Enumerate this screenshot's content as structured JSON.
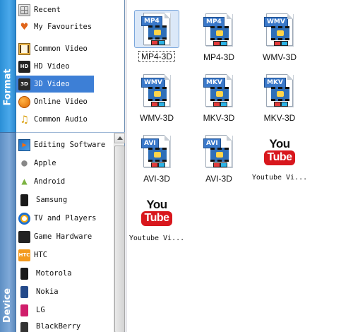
{
  "tabs": {
    "format": "Format",
    "device": "Device"
  },
  "format_categories": [
    {
      "label": "Recent",
      "icon": "grid-icon",
      "selected": false
    },
    {
      "label": "My Favourites",
      "icon": "heart-icon",
      "selected": false
    },
    {
      "label": "Common Video",
      "icon": "film-icon",
      "selected": false
    },
    {
      "label": "HD Video",
      "icon": "hd-icon",
      "badge": "HD",
      "selected": false
    },
    {
      "label": "3D Video",
      "icon": "3d-icon",
      "badge": "3D",
      "selected": true
    },
    {
      "label": "Online Video",
      "icon": "globe-icon",
      "selected": false
    },
    {
      "label": "Common Audio",
      "icon": "music-icon",
      "selected": false
    }
  ],
  "device_categories": [
    {
      "label": "Editing Software",
      "icon": "editing-icon"
    },
    {
      "label": "Apple",
      "icon": "apple-icon"
    },
    {
      "label": "Android",
      "icon": "android-icon"
    },
    {
      "label": "Samsung",
      "icon": "phone-icon"
    },
    {
      "label": "TV and Players",
      "icon": "tv-icon"
    },
    {
      "label": "Game Hardware",
      "icon": "gamepad-icon"
    },
    {
      "label": "HTC",
      "icon": "htc-icon",
      "badge": "HTC"
    },
    {
      "label": "Motorola",
      "icon": "phone-icon"
    },
    {
      "label": "Nokia",
      "icon": "phone-icon"
    },
    {
      "label": "LG",
      "icon": "phone-icon"
    },
    {
      "label": "BlackBerry",
      "icon": "phone-icon"
    }
  ],
  "formats": [
    {
      "label": "MP4-3D",
      "badge": "MP4",
      "selected": true
    },
    {
      "label": "MP4-3D",
      "badge": "MP4",
      "selected": false
    },
    {
      "label": "WMV-3D",
      "badge": "WMV",
      "selected": false
    },
    {
      "label": "WMV-3D",
      "badge": "WMV",
      "selected": false
    },
    {
      "label": "MKV-3D",
      "badge": "MKV",
      "selected": false
    },
    {
      "label": "MKV-3D",
      "badge": "MKV",
      "selected": false
    },
    {
      "label": "AVI-3D",
      "badge": "AVI",
      "selected": false
    },
    {
      "label": "AVI-3D",
      "badge": "AVI",
      "selected": false
    },
    {
      "label": "Youtube Vi...",
      "logo_top": "You",
      "logo_bottom": "Tube",
      "selected": false
    },
    {
      "label": "Youtube Vi...",
      "logo_top": "You",
      "logo_bottom": "Tube",
      "selected": false
    }
  ],
  "colors": {
    "selection": "#3d7fd6",
    "format_tab": "#3c9be2",
    "device_tab": "#6d9bd0",
    "youtube_red": "#d8171d"
  }
}
